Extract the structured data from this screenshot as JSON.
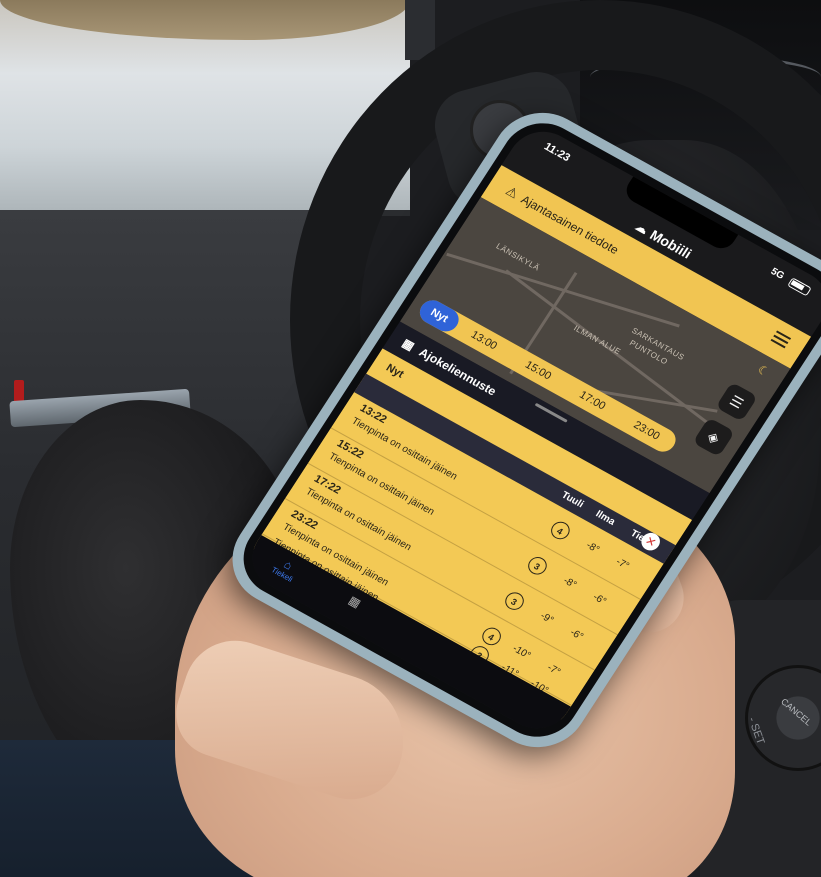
{
  "phone": {
    "status": {
      "time": "11:23",
      "network": "5G"
    },
    "app": {
      "name": "Mobiili"
    },
    "notice": {
      "text": "Ajantasainen tiedote"
    },
    "map": {
      "places": [
        "LÄNSIKYLÄ",
        "SARKANTAUS",
        "PUNTOLO",
        "ILMAN ALUE"
      ],
      "timeline": [
        {
          "label": "Nyt",
          "active": true
        },
        {
          "label": "13:00",
          "active": false
        },
        {
          "label": "15:00",
          "active": false
        },
        {
          "label": "17:00",
          "active": false
        },
        {
          "label": "23:00",
          "active": false
        }
      ]
    },
    "sheet": {
      "title": "Ajokeliennuste",
      "now_label": "Nyt",
      "columns": {
        "wind": "Tuuli",
        "air": "Ilma",
        "road": "Tie"
      },
      "rows": [
        {
          "time": "13:22",
          "text": "Tienpinta on osittain jäinen",
          "wind": "4",
          "air": "-8°",
          "road": "-7°"
        },
        {
          "time": "15:22",
          "text": "Tienpinta on osittain jäinen",
          "wind": "3",
          "air": "-8°",
          "road": "-6°"
        },
        {
          "time": "17:22",
          "text": "Tienpinta on osittain jäinen",
          "wind": "3",
          "air": "-9°",
          "road": "-6°"
        },
        {
          "time": "23:22",
          "text": "Tienpinta on osittain jäinen",
          "wind": "4",
          "air": "-10°",
          "road": "-7°"
        },
        {
          "time": "",
          "text": "Tienpinta on osittain jäinen",
          "wind": "3",
          "air": "-11°",
          "road": "-10°"
        }
      ]
    },
    "tabs": [
      {
        "label": "Tiekeli"
      }
    ]
  },
  "car": {
    "cruise_label": "CANCEL",
    "set_label": "- SET"
  }
}
